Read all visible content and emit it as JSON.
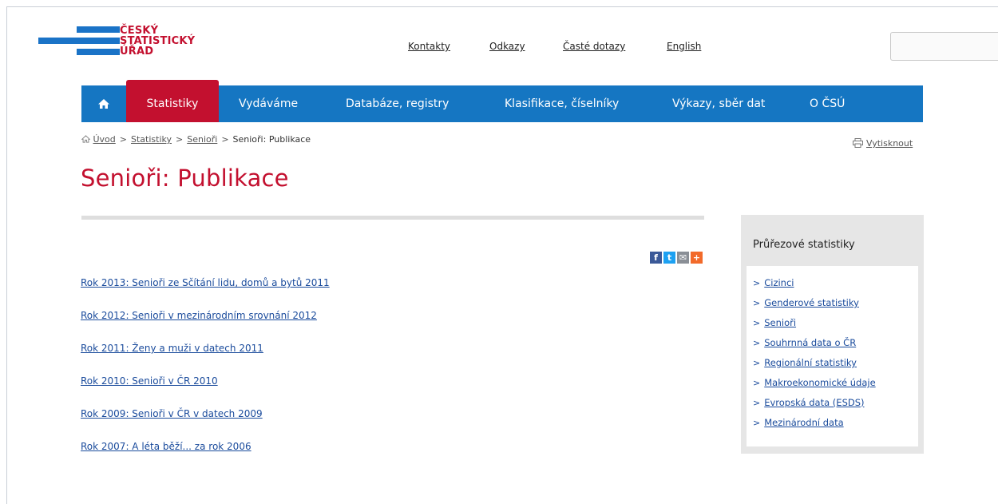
{
  "logo": {
    "lines": [
      "ČESKÝ",
      "STATISTICKÝ",
      "ÚŘAD"
    ]
  },
  "top_links": [
    "Kontakty",
    "Odkazy",
    "Časté dotazy",
    "English"
  ],
  "search": {
    "placeholder": ""
  },
  "nav": {
    "home_icon": "home-icon",
    "items": [
      "Statistiky",
      "Vydáváme",
      "Databáze, registry",
      "Klasifikace, číselníky",
      "Výkazy, sběr dat",
      "O ČSÚ"
    ],
    "active": "Statistiky"
  },
  "breadcrumb": {
    "items": [
      "Úvod",
      "Statistiky",
      "Senioři"
    ],
    "current": "Senioři: Publikace",
    "separator": ">"
  },
  "print_label": "Vytisknout",
  "page_title": "Senioři: Publikace",
  "share_icons": [
    "facebook-icon",
    "twitter-icon",
    "email-icon",
    "plus-icon"
  ],
  "publications": [
    "Rok 2013: Senioři ze Sčítání lidu, domů a bytů 2011",
    "Rok 2012: Senioři v mezinárodním srovnání 2012",
    "Rok 2011: Ženy a muži v datech 2011",
    "Rok 2010: Senioři v ČR 2010",
    "Rok 2009: Senioři v ČR v datech 2009",
    "Rok 2007: A léta běží... za rok 2006"
  ],
  "sidebar": {
    "title": "Průřezové statistiky",
    "links": [
      "Cizinci",
      "Genderové statistiky",
      "Senioři",
      "Souhrnná data o ČR",
      "Regionální statistiky",
      "Makroekonomické údaje",
      "Evropská data (ESDS)",
      "Mezinárodní data"
    ]
  },
  "colors": {
    "brand_red": "#c3102f",
    "nav_blue": "#1576c2",
    "link_blue": "#1a4b9c"
  }
}
